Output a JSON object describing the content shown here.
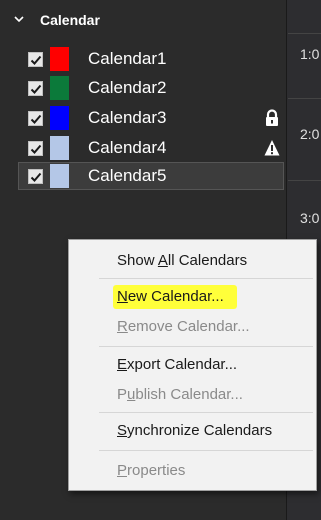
{
  "sidebar": {
    "header_title": "Calendar",
    "calendars": [
      {
        "label": "Calendar1",
        "color": "#ff0000",
        "status": ""
      },
      {
        "label": "Calendar2",
        "color": "#0b7a3a",
        "status": ""
      },
      {
        "label": "Calendar3",
        "color": "#0000ff",
        "status": "lock-icon"
      },
      {
        "label": "Calendar4",
        "color": "#b4c7e7",
        "status": "warning-icon"
      },
      {
        "label": "Calendar5",
        "color": "#b4c7e7",
        "status": ""
      }
    ]
  },
  "main": {
    "times": [
      "1:0",
      "2:0",
      "3:0"
    ]
  },
  "context_menu": {
    "items": [
      {
        "pre": "Show ",
        "key": "A",
        "post": "ll Calendars",
        "enabled": true
      },
      {
        "pre": "",
        "key": "N",
        "post": "ew Calendar...",
        "enabled": true,
        "highlighted": true
      },
      {
        "pre": "",
        "key": "R",
        "post": "emove Calendar...",
        "enabled": false
      },
      {
        "pre": "",
        "key": "E",
        "post": "xport Calendar...",
        "enabled": true
      },
      {
        "pre": "P",
        "key": "u",
        "post": "blish Calendar...",
        "enabled": false
      },
      {
        "pre": "",
        "key": "S",
        "post": "ynchronize Calendars",
        "enabled": true
      },
      {
        "pre": "",
        "key": "P",
        "post": "roperties",
        "enabled": false
      }
    ]
  }
}
